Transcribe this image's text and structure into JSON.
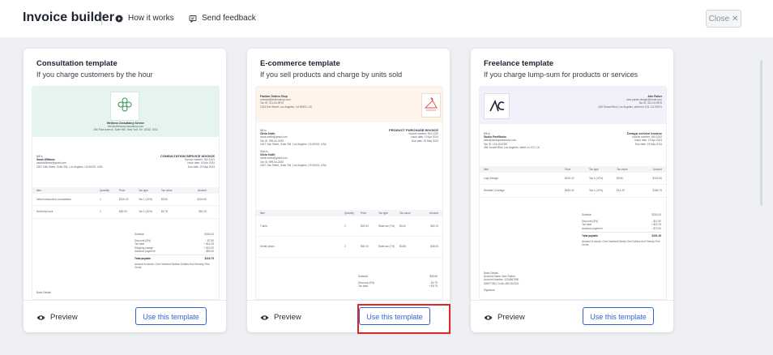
{
  "header": {
    "title": "Invoice builder",
    "how_it_works": "How it works",
    "send_feedback": "Send feedback",
    "close_label": "Close ✕"
  },
  "cards": [
    {
      "title": "Consultation template",
      "subtitle": "If you charge customers by the hour",
      "preview_label": "Preview",
      "use_label": "Use this template",
      "doc": {
        "company": "Wellness Consultancy Service",
        "company_lines": [
          "info@wellnessconsultancy.com",
          "456 Park Avenue, Suite 550, New York, NY 10022, USA"
        ],
        "bill_to": "Bill to",
        "client": "Sarah Williams",
        "client_lines": [
          "sarahwilliams@gmail.com",
          "2457 Oak Street, Suite 304, Los Angeles, CA 90001, USA"
        ],
        "doc_title": "CONSULTATION SERVICE INVOICE",
        "meta": [
          "Invoice number: INV-1001",
          "Issue date: 19 Apr 2024",
          "Due date: 19 May 2024"
        ],
        "columns": [
          "Item",
          "Quantity",
          "Price",
          "Tax type",
          "Tax value",
          "Amount"
        ],
        "rows": [
          [
            "Initial introductory consultation",
            "1",
            "$100.00",
            "Tax 1 (10%)",
            "$9.50",
            "$104.50"
          ],
          [
            "Self-help book",
            "1",
            "$50.00",
            "Tax 1 (10%)",
            "$4.75",
            "$52.25"
          ]
        ],
        "totals": [
          [
            "Subtotal",
            "$150.00"
          ],
          [
            "Discount (5%)",
            "- $7.50"
          ],
          [
            "Tax total",
            "+ $14.25"
          ],
          [
            "Shipping charge",
            "+ $10.00"
          ],
          [
            "Advance payment",
            "- $50.00"
          ],
          [
            "Total payable",
            "$116.75"
          ]
        ],
        "words": "Amount in words: One Hundred Sixteen Dollars And Seventy Five Cents",
        "bank": "Bank Details"
      }
    },
    {
      "title": "E-commerce template",
      "subtitle": "If you sell products and charge by units sold",
      "preview_label": "Preview",
      "use_label": "Use this template",
      "doc": {
        "company": "Fashion Clothes Shop",
        "company_lines": [
          "contact@fashionshop.com",
          "Tax ID: 321-54-9876",
          "1234 Elm Street, Los Angeles, CA 90001, US"
        ],
        "bill_to": "Bill to",
        "client": "Olivia Smith",
        "client_lines": [
          "olivia.smith@gmail.com",
          "Tax ID: 999-54-2435",
          "2457 Oak Street, Suite 304, Los Angeles, CA 90001, USA"
        ],
        "ship_to": "Ship to",
        "ship_client": "Olivia Smith",
        "ship_lines": [
          "olivia.smith@gmail.com",
          "Tax ID: 999-54-2435",
          "2457 Oak Street, Suite 304, Los Angeles, CA 90001, USA"
        ],
        "doc_title": "PRODUCT PURCHASE INVOICE",
        "meta": [
          "Invoice number: INV-1000",
          "Issue date: 19 Apr 2024",
          "Due date: 19 May 2024"
        ],
        "columns": [
          "Item",
          "Quantity",
          "Price",
          "Tax type",
          "Tax value",
          "Amount"
        ],
        "rows": [
          [
            "T-shirt",
            "2",
            "$25.00",
            "State tax (7%)",
            "$3.00",
            "$53.70"
          ],
          [
            "Denim jeans",
            "2",
            "$45.00",
            "State tax (7%)",
            "$3.88",
            "$48.00"
          ]
        ],
        "totals": [
          [
            "Subtotal",
            "$95.80"
          ],
          [
            "Discount (5%)",
            "- $4.79"
          ],
          [
            "Tax total",
            "+ $9.79"
          ]
        ]
      }
    },
    {
      "title": "Freelance template",
      "subtitle": "If you charge lump-sum for products or services",
      "preview_label": "Preview",
      "use_label": "Use this template",
      "doc": {
        "company": "Alex Parker",
        "company_lines": [
          "alex.parker.design@email.com",
          "Tax ID: 321-54-9876",
          "456 Sunset Blvd, Los Angeles, street no 123, CA 90001"
        ],
        "bill_to": "Bill to",
        "client": "Studio PixelWorks",
        "client_lines": [
          "hello@studiopixelworks.com",
          "Tax ID: 123-45-6789",
          "456 Sunset Blvd, Los Angeles, street no 123, CA"
        ],
        "doc_title": "Design service invoice",
        "meta": [
          "Invoice number: INV-1002",
          "Issue date: 19 Apr 2024",
          "Due date: 19 May 2024"
        ],
        "columns": [
          "Item",
          "Price",
          "Tax type",
          "Tax value",
          "Amount"
        ],
        "rows": [
          [
            "Logo Design",
            "$100.00",
            "Tax 1 (10%)",
            "$9.50",
            "$104.50"
          ],
          [
            "Website UI design",
            "$150.00",
            "Tax 1 (10%)",
            "$14.25",
            "$156.75"
          ]
        ],
        "totals": [
          [
            "Subtotal",
            "$250.00"
          ],
          [
            "Discount (5%)",
            "- $12.50"
          ],
          [
            "Tax total",
            "+ $23.75"
          ],
          [
            "Advance payment",
            "- $70.00"
          ],
          [
            "Total payable",
            "$191.25"
          ]
        ],
        "words": "Amount in words: One Hundred Ninety One Dollars And Twenty Five Cents",
        "bank": "Bank Details",
        "bank_lines": [
          "Account Name: Alex Parker",
          "Account Number: 1234567890",
          "SWIFT/BIC Code: ABCDUS33"
        ],
        "signature": "Signature"
      }
    }
  ],
  "colors": {
    "accent": "#2f66d6",
    "highlight": "#e0262b",
    "consult_band": "#e6f4ee",
    "ecom_band": "#fff4ea",
    "free_band": "#f4f0fb"
  }
}
